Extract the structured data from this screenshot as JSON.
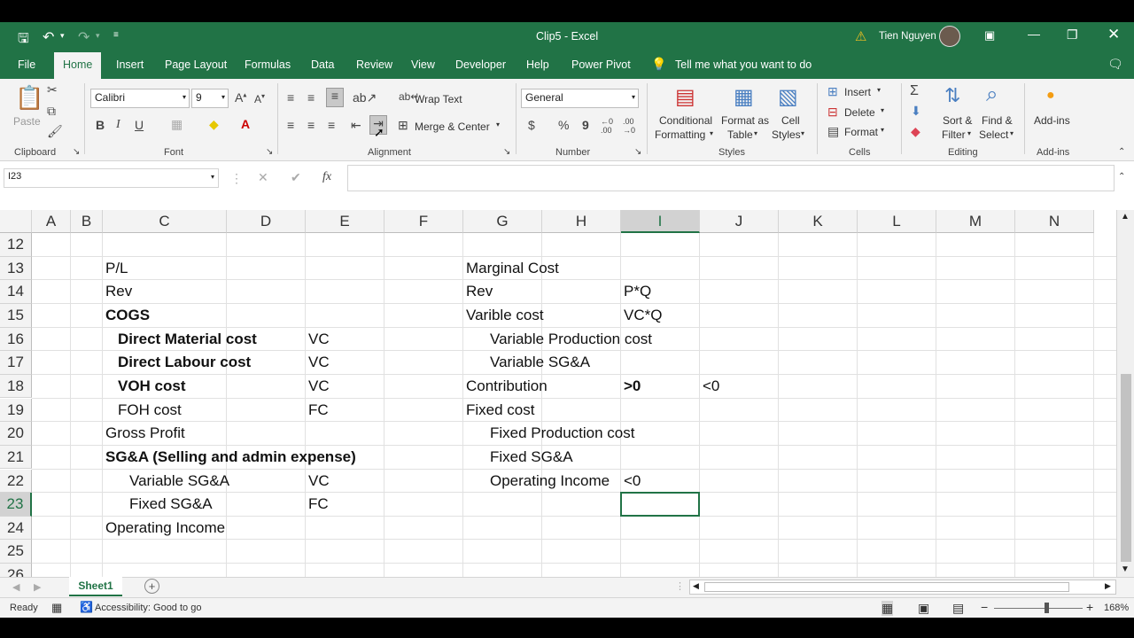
{
  "window": {
    "title": "Clip5  -  Excel",
    "user": "Tien Nguyen",
    "warning_icon": "warning-icon",
    "colors": {
      "brand": "#217346",
      "selection": "#217346"
    }
  },
  "menu": {
    "file": "File",
    "tabs": [
      "Home",
      "Insert",
      "Page Layout",
      "Formulas",
      "Data",
      "Review",
      "View",
      "Developer",
      "Help",
      "Power Pivot"
    ],
    "tell_me": "Tell me what you want to do"
  },
  "ribbon": {
    "clipboard": {
      "paste": "Paste",
      "label": "Clipboard"
    },
    "font": {
      "name": "Calibri",
      "size": "9",
      "bold": "B",
      "italic": "I",
      "underline": "U",
      "label": "Font"
    },
    "alignment": {
      "wrap": "Wrap Text",
      "merge": "Merge & Center",
      "label": "Alignment"
    },
    "number": {
      "format": "General",
      "currency": "$",
      "percent": "%",
      "comma": "9",
      "label": "Number"
    },
    "styles": {
      "conditional": "Conditional",
      "conditional2": "Formatting",
      "format_as": "Format as",
      "format_as2": "Table",
      "cell": "Cell",
      "cell2": "Styles",
      "label": "Styles"
    },
    "cells": {
      "insert": "Insert",
      "delete": "Delete",
      "format": "Format",
      "label": "Cells"
    },
    "editing": {
      "sort": "Sort &",
      "sort2": "Filter",
      "find": "Find &",
      "find2": "Select",
      "label": "Editing"
    },
    "addins": {
      "name": "Add-ins",
      "label": "Add-ins"
    }
  },
  "formula_bar": {
    "name_box": "I23",
    "fx": "fx",
    "value": ""
  },
  "grid": {
    "columns": [
      "A",
      "B",
      "C",
      "D",
      "E",
      "F",
      "G",
      "H",
      "I",
      "J",
      "K",
      "L",
      "M",
      "N"
    ],
    "selected_column": "I",
    "rows": [
      "12",
      "13",
      "14",
      "15",
      "16",
      "17",
      "18",
      "19",
      "20",
      "21",
      "22",
      "23",
      "24",
      "25",
      "26"
    ],
    "selected_row": "23",
    "cells": {
      "C13": "P/L",
      "C14": "Rev",
      "C15": "COGS",
      "C16": "Direct Material cost",
      "E16": "VC",
      "C17": "Direct Labour cost",
      "E17": "VC",
      "C18": "VOH cost",
      "E18": "VC",
      "C19": "FOH cost",
      "E19": "FC",
      "C20": "Gross Profit",
      "C21": "SG&A (Selling and admin expense)",
      "C22": "Variable SG&A",
      "E22": "VC",
      "C23": "Fixed SG&A",
      "E23": "FC",
      "C24": "Operating Income",
      "G13": "Marginal Cost",
      "G14": "Rev",
      "I14": "P*Q",
      "G15": "Varible cost",
      "I15": "VC*Q",
      "G16": "Variable Production cost",
      "G17": "Variable SG&A",
      "G18": "Contribution",
      "I18": ">0",
      "J18": "<0",
      "G19": "Fixed cost",
      "G20": "Fixed Production cost",
      "G21": "Fixed SG&A",
      "G22": "Operating Income",
      "I22": "<0"
    }
  },
  "sheets": {
    "active": "Sheet1",
    "add": "+"
  },
  "status": {
    "ready": "Ready",
    "accessibility": "Accessibility: Good to go",
    "zoom": "168%"
  }
}
